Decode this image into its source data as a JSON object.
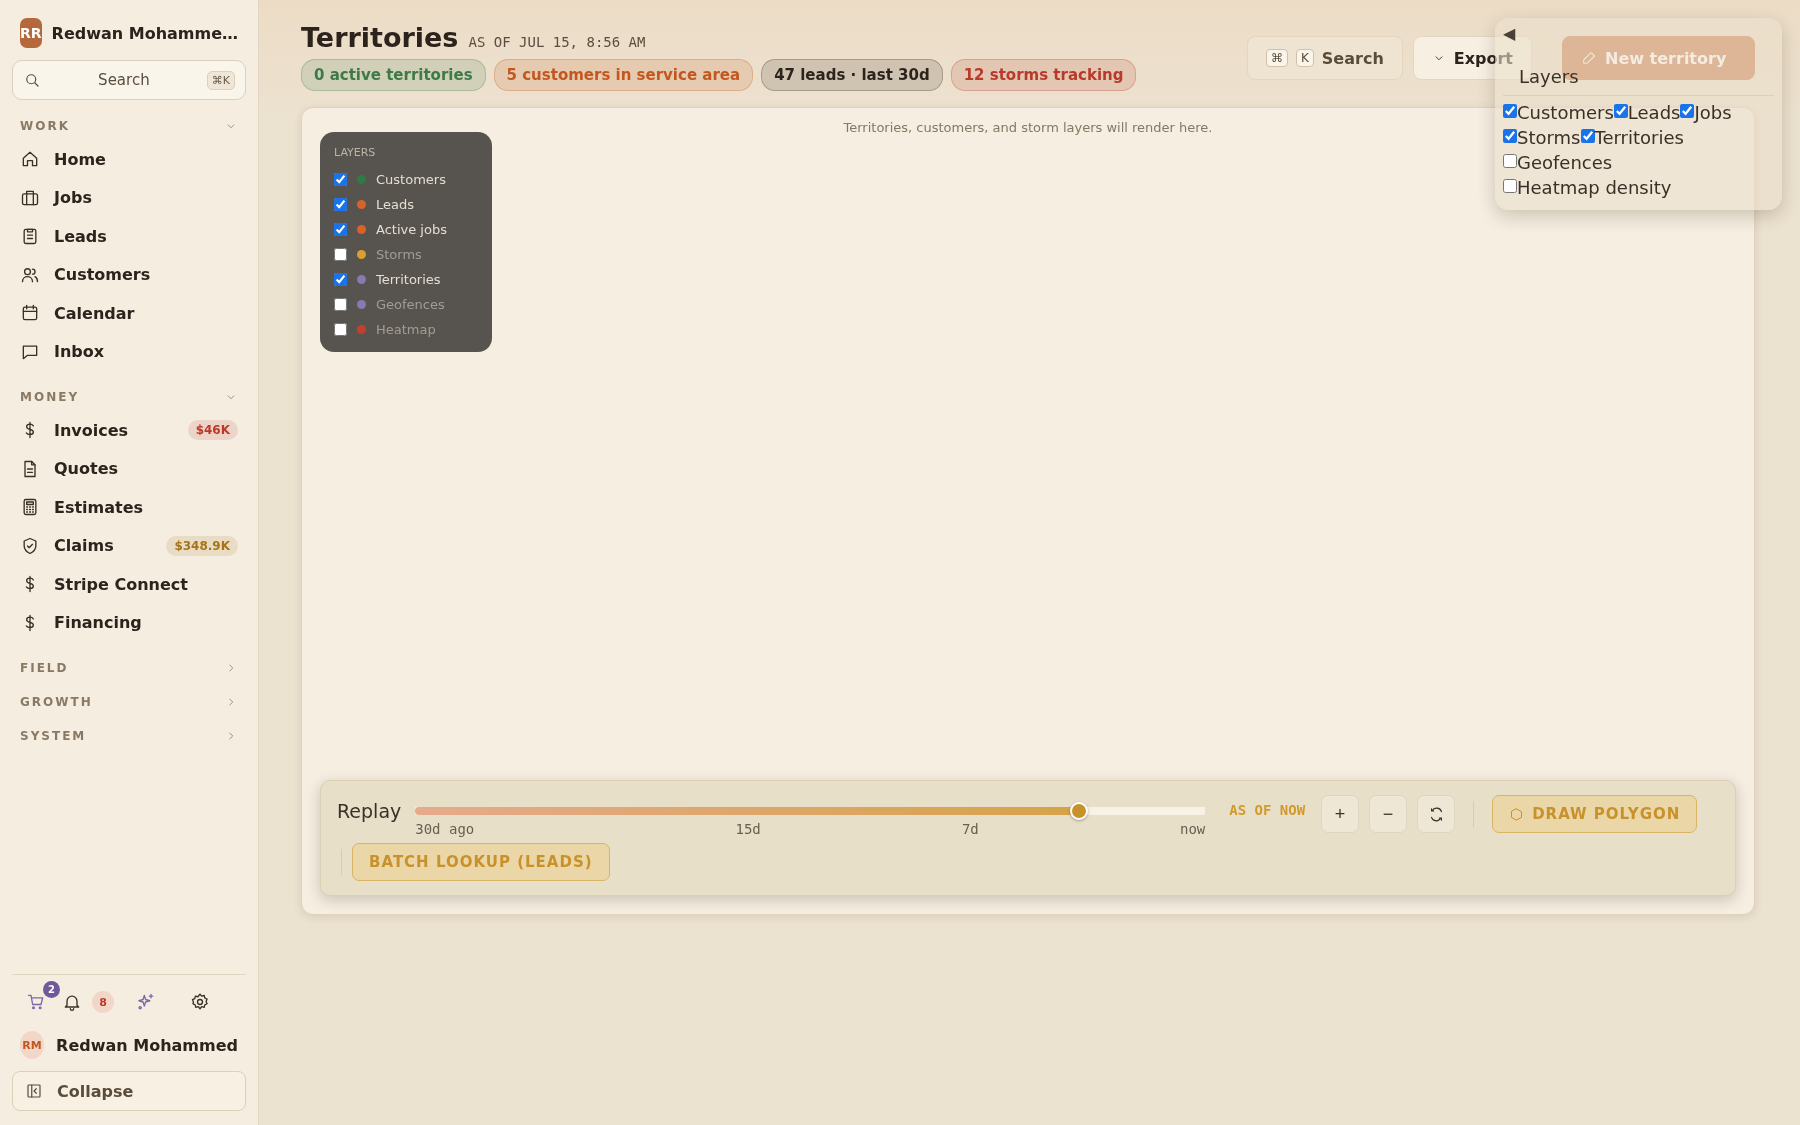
{
  "workspace": {
    "initials": "RR",
    "name": "Redwan Mohamme…"
  },
  "sidebar_search": {
    "placeholder": "Search",
    "shortcut": "⌘K"
  },
  "nav_sections": [
    {
      "label": "WORK",
      "expanded": true,
      "items": [
        {
          "label": "Home"
        },
        {
          "label": "Jobs"
        },
        {
          "label": "Leads"
        },
        {
          "label": "Customers"
        },
        {
          "label": "Calendar"
        },
        {
          "label": "Inbox"
        }
      ]
    },
    {
      "label": "MONEY",
      "expanded": true,
      "items": [
        {
          "label": "Invoices",
          "badge": {
            "text": "$46K",
            "color": "#b83a2a"
          }
        },
        {
          "label": "Quotes"
        },
        {
          "label": "Estimates"
        },
        {
          "label": "Claims",
          "badge": {
            "text": "$348.9K",
            "color": "#a8741a"
          }
        },
        {
          "label": "Stripe Connect"
        },
        {
          "label": "Financing"
        }
      ]
    },
    {
      "label": "FIELD",
      "expanded": false
    },
    {
      "label": "GROWTH",
      "expanded": false
    },
    {
      "label": "SYSTEM",
      "expanded": false
    }
  ],
  "sidebar_footer": {
    "cart_count": "2",
    "notification_count": "8",
    "user": {
      "initials": "RM",
      "name": "Redwan Mohammed"
    },
    "collapse": "Collapse"
  },
  "header": {
    "title": "Territories",
    "as_of": "AS OF JUL 15, 8:56 AM",
    "chips": [
      {
        "text": "0 active territories",
        "color": "#3d7a48"
      },
      {
        "text": "5 customers in service area",
        "color": "#c4571e"
      },
      {
        "text": "47 leads · last 30d",
        "color": "#2c241c"
      },
      {
        "text": "12 storms tracking",
        "color": "#b83a2a"
      }
    ],
    "search_button": {
      "keys": [
        "⌘",
        "K"
      ],
      "label": "Search"
    },
    "export_button": {
      "label": "Export"
    },
    "new_button": {
      "label": "New territory",
      "disabled": true
    }
  },
  "map": {
    "placeholder": "Territories, customers, and storm layers will render here.",
    "layers_panel": {
      "title": "LAYERS",
      "items": [
        {
          "label": "Customers",
          "checked": true,
          "color": "#2f7a45"
        },
        {
          "label": "Leads",
          "checked": true,
          "color": "#d9622a"
        },
        {
          "label": "Active jobs",
          "checked": true,
          "color": "#d9622a"
        },
        {
          "label": "Storms",
          "checked": false,
          "color": "#d9a030"
        },
        {
          "label": "Territories",
          "checked": true,
          "color": "#8a78b0"
        },
        {
          "label": "Geofences",
          "checked": false,
          "color": "#8a78b0"
        },
        {
          "label": "Heatmap",
          "checked": false,
          "color": "#c4402a"
        }
      ]
    },
    "replay": {
      "label": "Replay",
      "level": 0.84,
      "ticks": [
        "30d ago",
        "15d",
        "7d",
        "now"
      ],
      "status": "AS OF NOW",
      "zoom_in": "+",
      "zoom_out": "−",
      "draw_button": "DRAW POLYGON",
      "batch_button": "BATCH LOOKUP (LEADS)"
    }
  },
  "layers_popup": {
    "toggle": "◀",
    "title": "Layers",
    "items": [
      {
        "label": "Customers",
        "checked": true
      },
      {
        "label": "Leads",
        "checked": true
      },
      {
        "label": "Jobs",
        "checked": true
      },
      {
        "label": "Storms",
        "checked": true
      },
      {
        "label": "Territories",
        "checked": true
      },
      {
        "label": "Geofences",
        "checked": false
      },
      {
        "label": "Heatmap density",
        "checked": false
      }
    ]
  }
}
